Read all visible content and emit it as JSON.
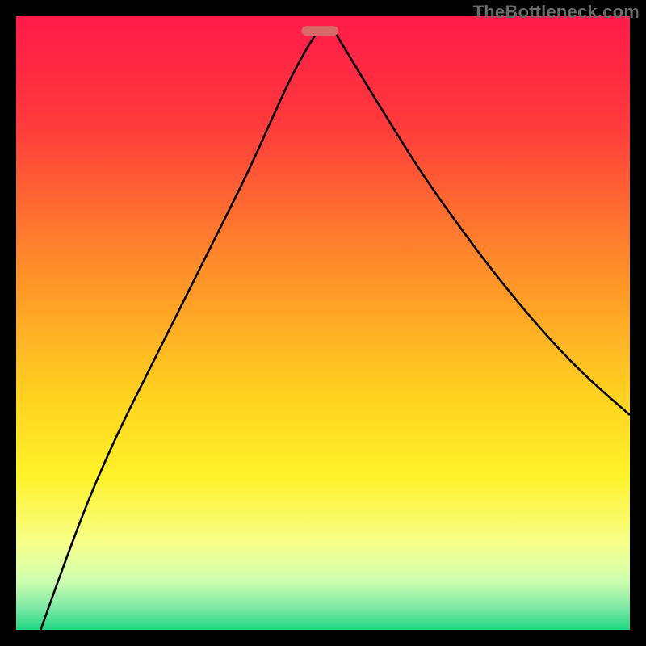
{
  "credit_text": "TheBottleneck.com",
  "chart_data": {
    "type": "line",
    "title": "",
    "xlabel": "",
    "ylabel": "",
    "xlim": [
      0,
      100
    ],
    "ylim": [
      0,
      100
    ],
    "gradient_stops": [
      {
        "offset": 0,
        "color": "#ff1a4a"
      },
      {
        "offset": 0.18,
        "color": "#ff3b3b"
      },
      {
        "offset": 0.4,
        "color": "#ff8a2b"
      },
      {
        "offset": 0.62,
        "color": "#ffd21f"
      },
      {
        "offset": 0.75,
        "color": "#fff22a"
      },
      {
        "offset": 0.86,
        "color": "#f6ff8a"
      },
      {
        "offset": 0.92,
        "color": "#cfffb0"
      },
      {
        "offset": 0.965,
        "color": "#7be8a5"
      },
      {
        "offset": 1.0,
        "color": "#1ed883"
      }
    ],
    "optimum_marker": {
      "x": 49.5,
      "y": 97.6,
      "width": 6.0,
      "height": 1.6,
      "color": "#d86a6a",
      "rx": 0.8
    },
    "series": [
      {
        "name": "left-curve",
        "color": "#000000",
        "stroke_width": 2.6,
        "points": [
          {
            "x": 4.0,
            "y": 0.0
          },
          {
            "x": 10.0,
            "y": 17.0
          },
          {
            "x": 16.0,
            "y": 31.0
          },
          {
            "x": 22.0,
            "y": 43.0
          },
          {
            "x": 28.0,
            "y": 55.0
          },
          {
            "x": 33.0,
            "y": 65.0
          },
          {
            "x": 38.0,
            "y": 75.0
          },
          {
            "x": 42.0,
            "y": 84.0
          },
          {
            "x": 45.0,
            "y": 90.5
          },
          {
            "x": 47.5,
            "y": 95.0
          },
          {
            "x": 49.0,
            "y": 97.3
          }
        ]
      },
      {
        "name": "right-curve",
        "color": "#000000",
        "stroke_width": 2.6,
        "points": [
          {
            "x": 52.0,
            "y": 97.3
          },
          {
            "x": 54.0,
            "y": 94.0
          },
          {
            "x": 57.0,
            "y": 89.0
          },
          {
            "x": 61.0,
            "y": 82.5
          },
          {
            "x": 66.0,
            "y": 74.5
          },
          {
            "x": 72.0,
            "y": 66.0
          },
          {
            "x": 78.0,
            "y": 58.0
          },
          {
            "x": 85.0,
            "y": 49.5
          },
          {
            "x": 92.0,
            "y": 42.0
          },
          {
            "x": 100.0,
            "y": 35.0
          }
        ]
      }
    ]
  }
}
